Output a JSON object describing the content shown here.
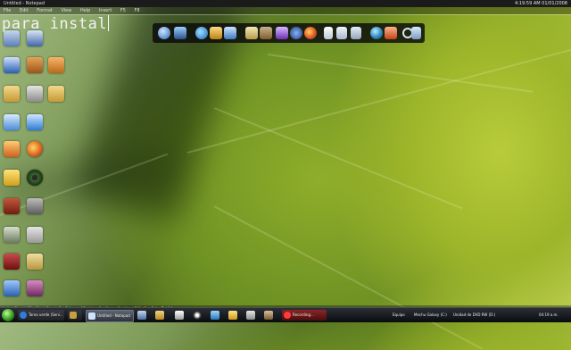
{
  "notepad": {
    "title": "Untitled - Notepad",
    "menu": [
      "File",
      "Edit",
      "Format",
      "View",
      "Help",
      "Insert",
      "F5",
      "F8"
    ],
    "text": "para instal",
    "status": {
      "letters": "Letter Count: 11",
      "words": "Word Count: 2",
      "column": "Column: 12",
      "line": "Line: 1",
      "mouse": "Mouse Position (790, 6)",
      "color": "Color To Write"
    }
  },
  "top_clock": "4:19:59 AM 01/01/2008",
  "dock": {
    "icons": [
      "globe-icon",
      "monitor-icon",
      "ie-icon",
      "lock-icon",
      "folder-icon",
      "box-icon",
      "sticky-icon",
      "cup-icon",
      "media-icon",
      "firefox-icon",
      "document-icon",
      "documents-icon",
      "notes-icon",
      "earth-icon",
      "picture-icon",
      "search-icon",
      "recycle-bin-icon"
    ]
  },
  "desktop_icons": [
    "computer-icon",
    "network-icon",
    "user-folder-icon",
    "control-panel-icon",
    "folder-icon",
    "folder-icon",
    "folder-icon",
    "folder-icon",
    "chat-icon",
    "shield-icon",
    "firefox-icon",
    "app-icon",
    "badge-icon",
    "disc-icon",
    "media-icon",
    "tools-icon",
    "photo-icon",
    "pdf-icon",
    "archive-icon",
    "folder-icon",
    "settings-icon",
    "globe-icon"
  ],
  "taskbar": {
    "items": [
      {
        "label": "Tarea verde (Seni...",
        "icon": "ie-icon"
      },
      {
        "label": "",
        "icon": "app-icon"
      },
      {
        "label": "Untitled - Notepad",
        "icon": "notepad-icon"
      },
      {
        "label": "Recording...",
        "icon": "record-icon"
      }
    ],
    "quick_launch": [
      "explorer-icon",
      "calc-icon",
      "folder-icon",
      "winamp-icon",
      "app-icon",
      "star-icon",
      "media-icon",
      "cube-icon"
    ],
    "tray": {
      "equipo": "Equipo",
      "disk_c": "Mechu Galaxy (C:)",
      "dvd": "Unidad de DVD RW (D:)",
      "time": "04:19 a.m."
    }
  },
  "colors": {
    "accent": "#ffd200",
    "taskbar": "#0b0d10",
    "dock": "#0a0a0a"
  }
}
